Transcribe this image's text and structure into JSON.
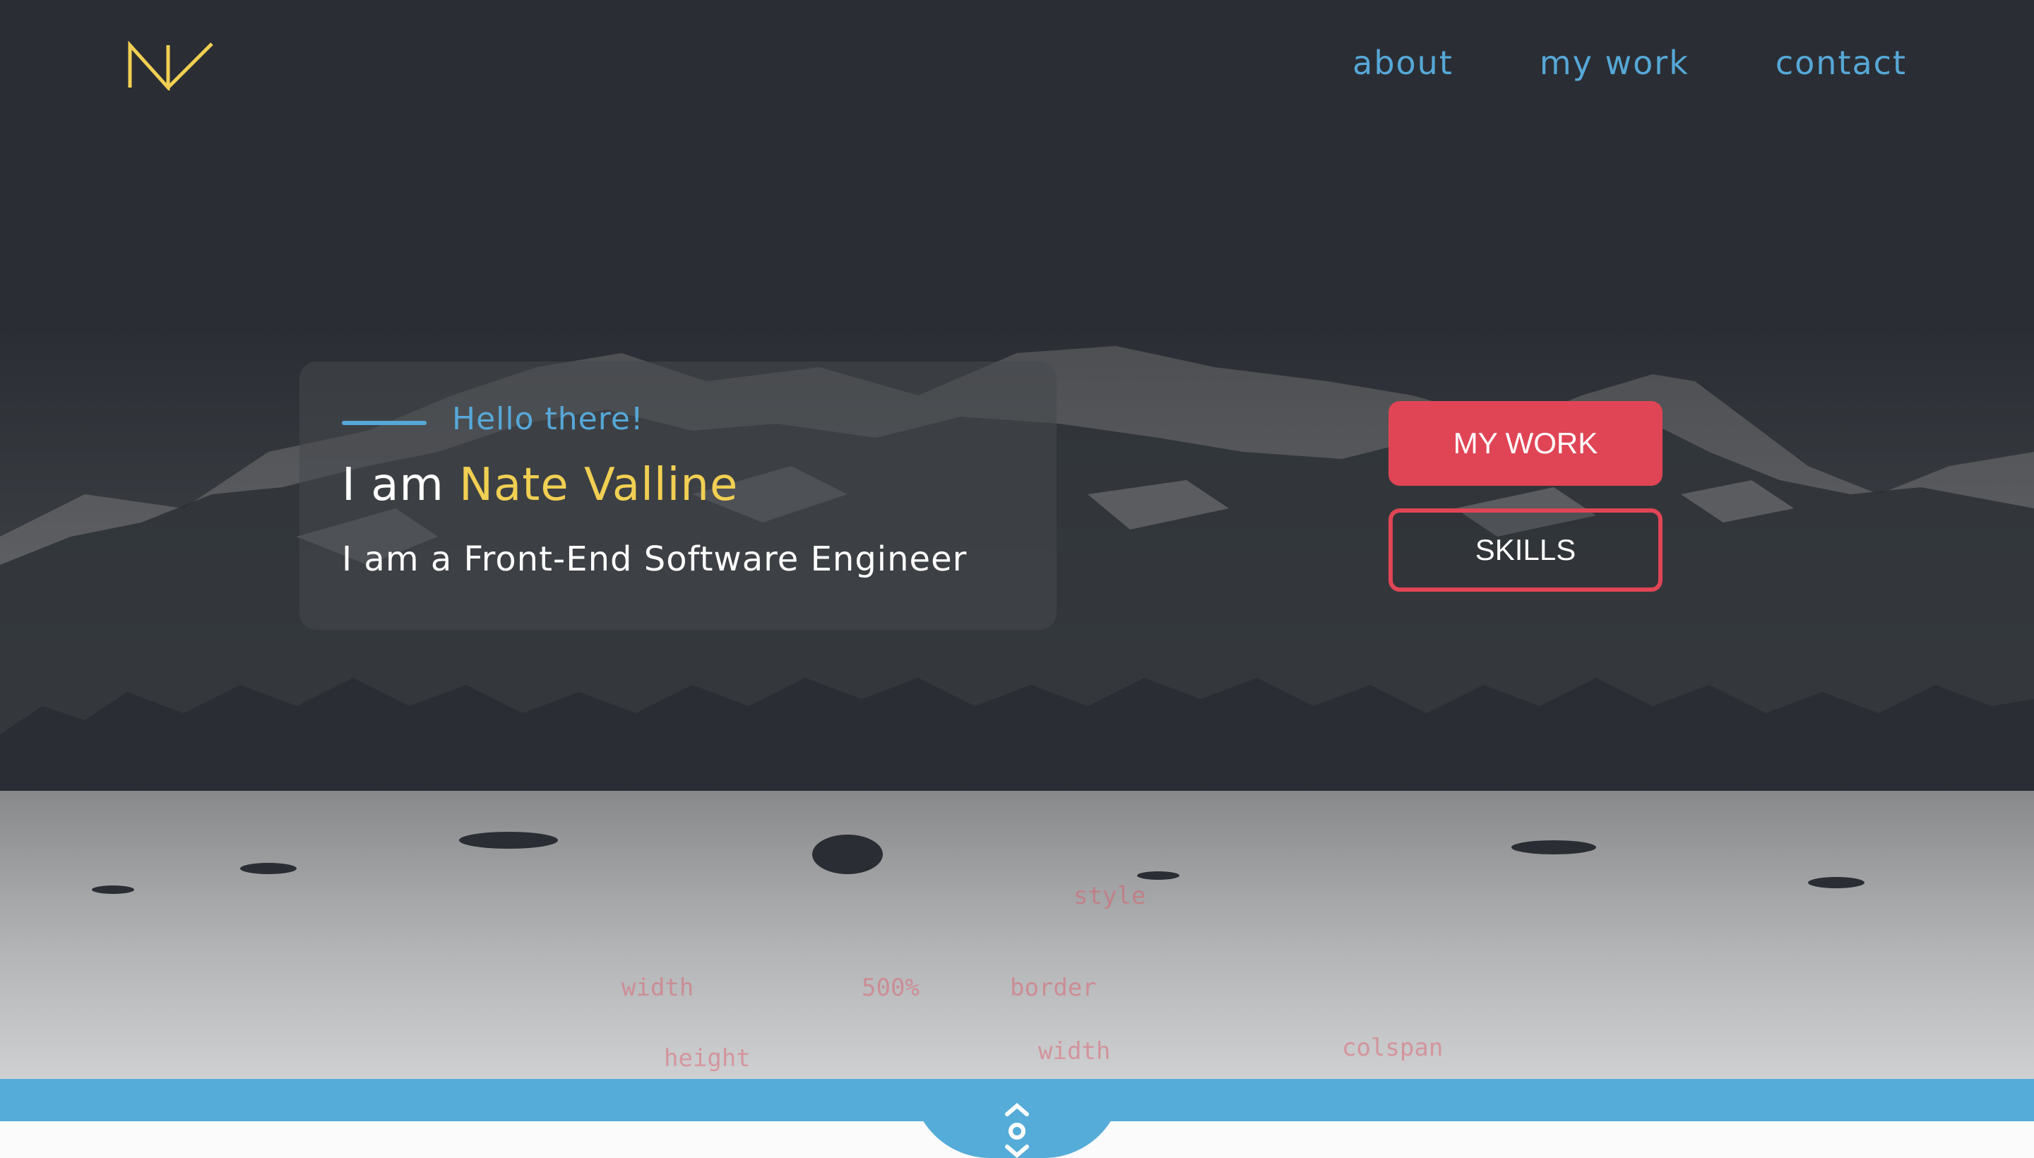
{
  "header": {
    "logo_text": "NV",
    "nav": [
      {
        "label": "about"
      },
      {
        "label": "my work"
      },
      {
        "label": "contact"
      }
    ]
  },
  "hero": {
    "greeting": "Hello there!",
    "intro_prefix": "I am ",
    "name": "Nate Valline",
    "role": "I am a Front-End Software Engineer",
    "buttons": {
      "primary": "MY WORK",
      "secondary": "SKILLS"
    }
  },
  "icons": {
    "scroll": "scroll-arrows-icon"
  },
  "colors": {
    "background": "#2a2e34",
    "accent_blue": "#56a8d8",
    "accent_yellow": "#f1cf52",
    "accent_red": "#e04555"
  }
}
